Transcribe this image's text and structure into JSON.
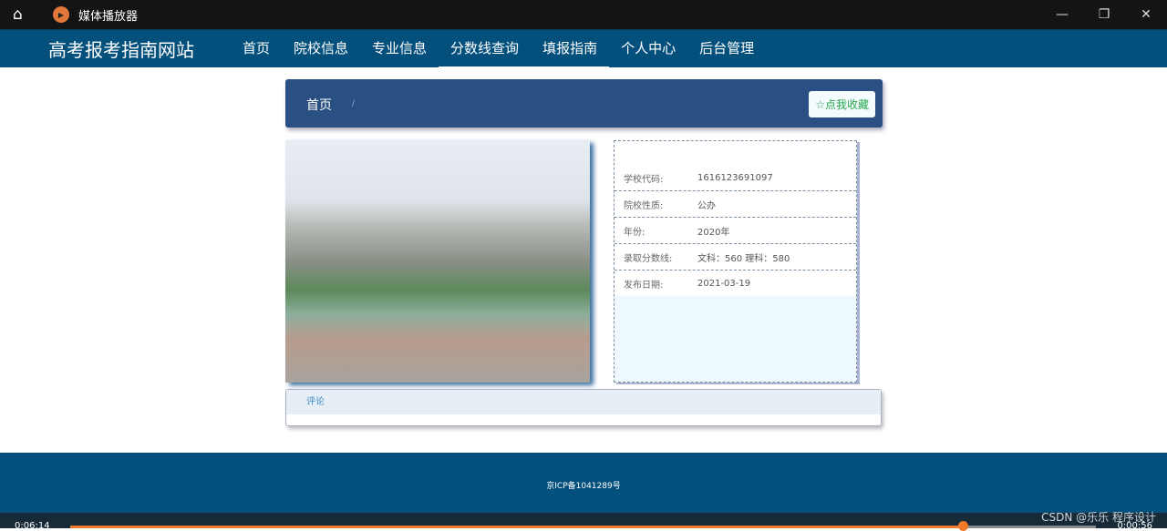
{
  "window": {
    "title": "媒体播放器",
    "minimize": "—",
    "restore": "❐",
    "close": "✕"
  },
  "nav": {
    "brand": "高考报考指南网站",
    "items": [
      "首页",
      "院校信息",
      "专业信息",
      "分数线查询",
      "填报指南",
      "个人中心",
      "后台管理"
    ]
  },
  "breadcrumb": {
    "home": "首页",
    "separator": "/",
    "favorite": "☆点我收藏"
  },
  "details": [
    {
      "label": "学校代码:",
      "value": "1616123691097"
    },
    {
      "label": "院校性质:",
      "value": "公办"
    },
    {
      "label": "年份:",
      "value": "2020年"
    },
    {
      "label": "录取分数线:",
      "value": "文科：560 理科：580"
    },
    {
      "label": "发布日期:",
      "value": "2021-03-19"
    }
  ],
  "comment": {
    "title": "评论"
  },
  "footer": {
    "icp": "京ICP备1041289号"
  },
  "player": {
    "elapsed": "0:06:14",
    "remaining": "0:00:56",
    "progress": 0.87
  },
  "watermark": "CSDN @乐乐 程序设计"
}
